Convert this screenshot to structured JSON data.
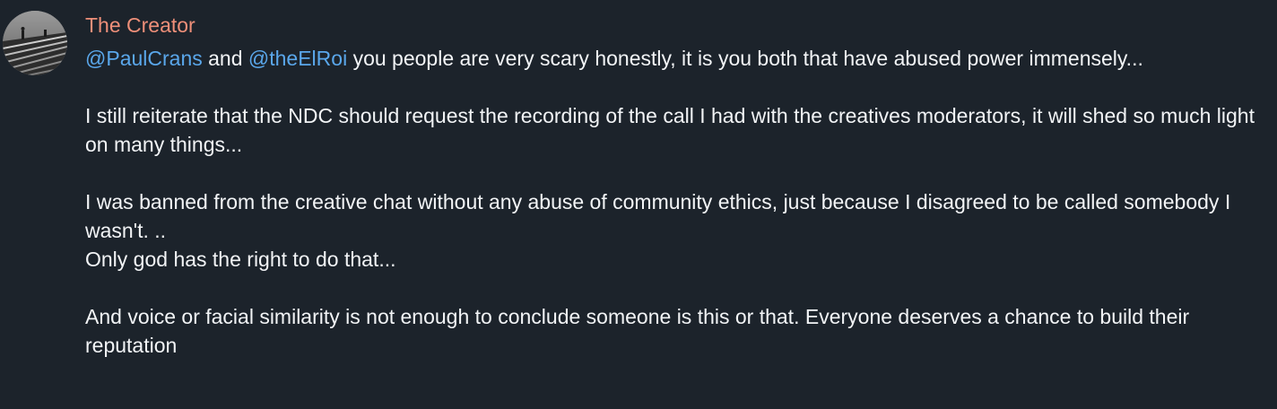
{
  "message": {
    "author": "The Creator",
    "mention_1": "@PaulCrans",
    "connector": " and ",
    "mention_2": "@theElRoi",
    "line_1_rest": " you people are very scary honestly, it is you both that have abused power immensely...",
    "paragraph_2": "I still reiterate that the NDC should request the recording of the call I had with the creatives moderators, it will shed so much light on many things...",
    "paragraph_3_line_1": "I was banned from the creative chat without any abuse of community ethics, just because I disagreed to be called somebody I wasn't. ..",
    "paragraph_3_line_2": "Only god has the right to do that...",
    "paragraph_4": "And voice or facial similarity is not enough to conclude someone is this or that. Everyone deserves a chance to build their reputation"
  },
  "colors": {
    "background": "#1c232b",
    "author_name": "#ee8f79",
    "mention": "#5aa7eb",
    "text": "#f2f4f6"
  },
  "icons": {
    "avatar": "avatar-photo"
  }
}
